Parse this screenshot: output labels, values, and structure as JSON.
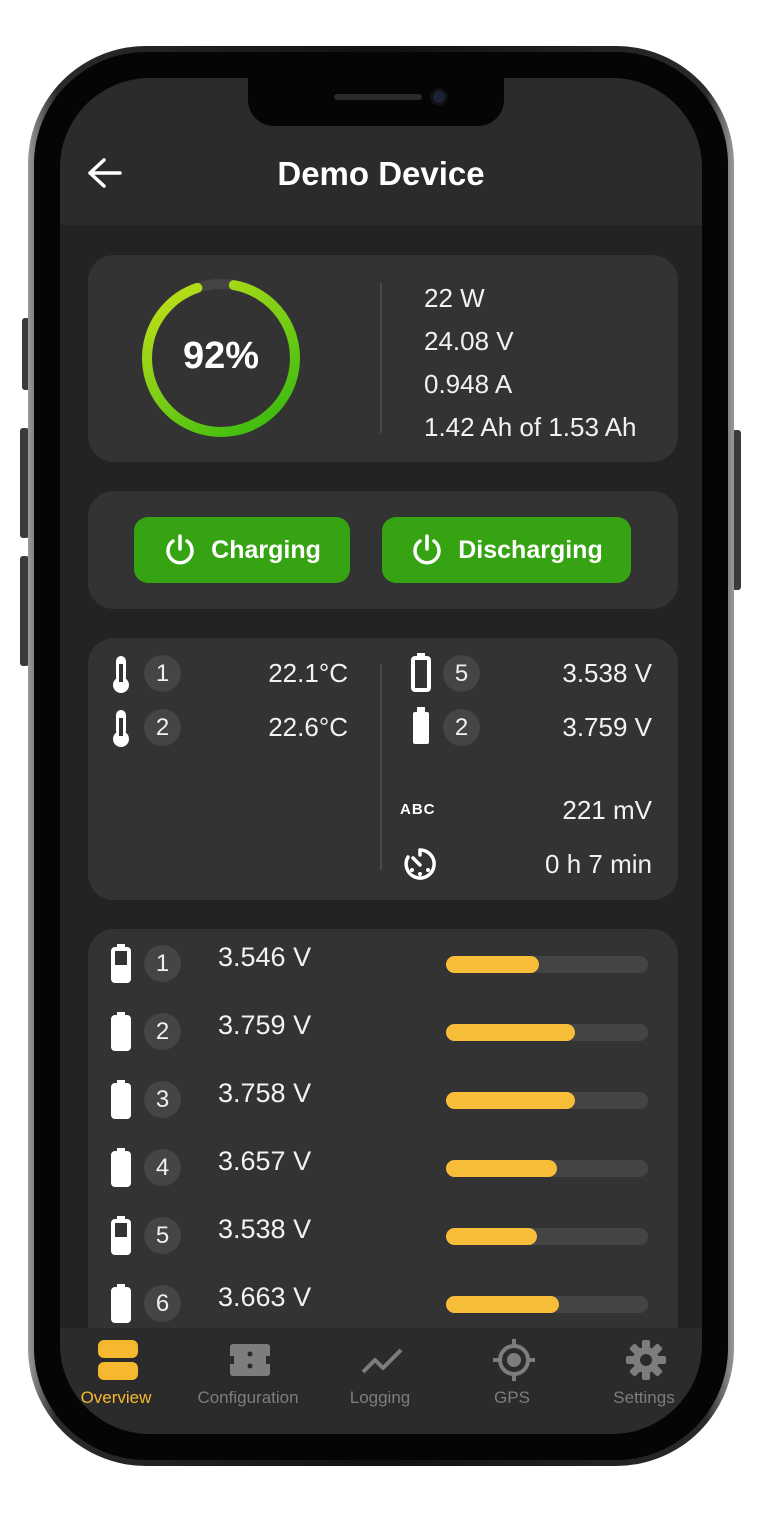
{
  "header": {
    "title": "Demo Device"
  },
  "summary": {
    "soc_label": "92%",
    "soc_fraction": 0.92,
    "gauge_colors": [
      "#2db80f",
      "#c8e21a"
    ],
    "power": "22 W",
    "voltage": "24.08 V",
    "current": "0.948 A",
    "capacity": "1.42 Ah of 1.53 Ah"
  },
  "controls": {
    "charging_label": "Charging",
    "discharging_label": "Discharging",
    "accent": "#36a312"
  },
  "sensors": {
    "temps": [
      {
        "id": "1",
        "value": "22.1°C"
      },
      {
        "id": "2",
        "value": "22.6°C"
      }
    ],
    "cells": [
      {
        "id": "5",
        "value": "3.538 V",
        "icon": "battery-empty-icon"
      },
      {
        "id": "2",
        "value": "3.759 V",
        "icon": "battery-full-icon"
      }
    ],
    "delta_icon_text": "ABC",
    "delta": "221 mV",
    "runtime": "0 h 7 min"
  },
  "cells": [
    {
      "id": "1",
      "value": "3.546 V",
      "level": 0.46
    },
    {
      "id": "2",
      "value": "3.759 V",
      "level": 0.64
    },
    {
      "id": "3",
      "value": "3.758 V",
      "level": 0.64
    },
    {
      "id": "4",
      "value": "3.657 V",
      "level": 0.55
    },
    {
      "id": "5",
      "value": "3.538 V",
      "level": 0.45
    },
    {
      "id": "6",
      "value": "3.663 V",
      "level": 0.56
    }
  ],
  "bar_color": "#f8be3a",
  "nav": {
    "items": [
      {
        "label": "Overview",
        "icon": "overview-icon",
        "active": true
      },
      {
        "label": "Configuration",
        "icon": "configuration-icon",
        "active": false
      },
      {
        "label": "Logging",
        "icon": "logging-icon",
        "active": false
      },
      {
        "label": "GPS",
        "icon": "gps-icon",
        "active": false
      },
      {
        "label": "Settings",
        "icon": "settings-icon",
        "active": false
      }
    ],
    "active_color": "#f6b82f"
  }
}
